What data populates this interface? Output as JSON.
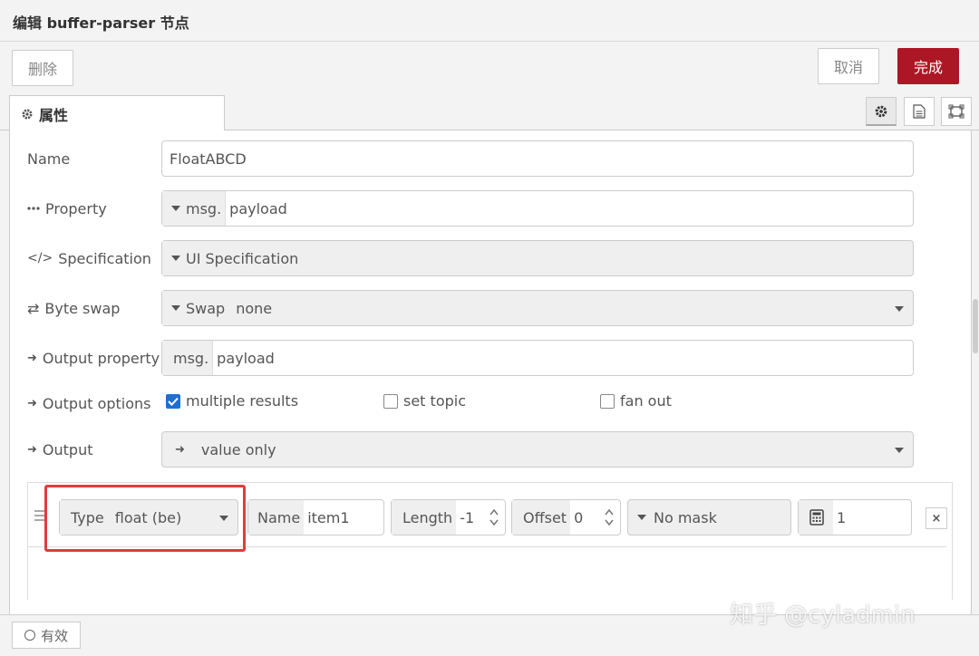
{
  "dialog": {
    "title": "编辑 buffer-parser 节点"
  },
  "toolbar": {
    "delete_label": "删除",
    "cancel_label": "取消",
    "done_label": "完成"
  },
  "tabs": {
    "properties_label": "属性"
  },
  "form": {
    "name_label": "Name",
    "name_value": "FloatABCD",
    "property_label": "Property",
    "property_prefix": "msg.",
    "property_value": "payload",
    "spec_label": "Specification",
    "spec_value": "UI Specification",
    "byteswap_label": "Byte swap",
    "byteswap_prefix": "Swap",
    "byteswap_value": "none",
    "outprop_label": "Output property",
    "outprop_prefix": "msg.",
    "outprop_value": "payload",
    "outopts_label": "Output options",
    "opt_multiple": "multiple results",
    "opt_settopic": "set topic",
    "opt_fanout": "fan out",
    "output_label": "Output",
    "output_value": "value only"
  },
  "spec_row": {
    "type_label": "Type",
    "type_value": "float (be)",
    "name_label": "Name",
    "name_value": "item1",
    "length_label": "Length",
    "length_value": "-1",
    "offset_label": "Offset",
    "offset_value": "0",
    "mask_value": "No mask",
    "scale_value": "1",
    "remove_label": "×"
  },
  "footer": {
    "valid_label": "有效"
  },
  "watermark": {
    "text": "知乎 @cyladmin"
  }
}
